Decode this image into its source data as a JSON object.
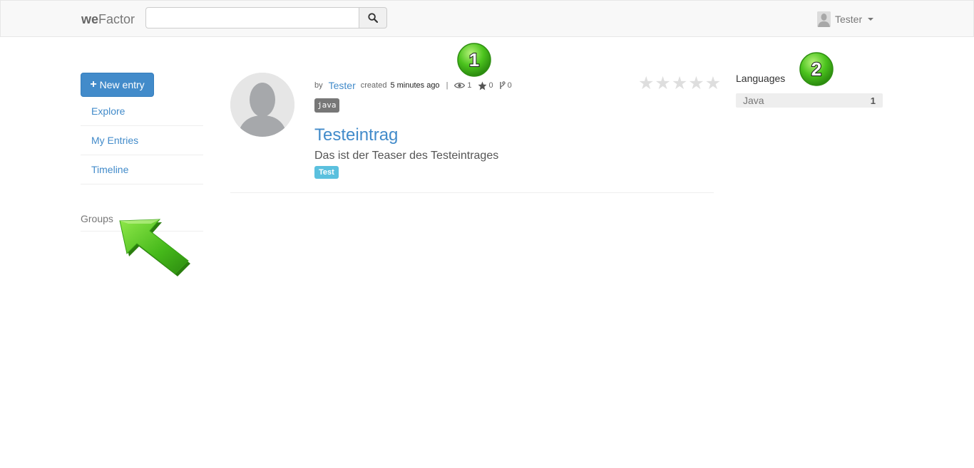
{
  "navbar": {
    "brand_bold": "we",
    "brand_rest": "Factor",
    "search": {
      "value": "",
      "placeholder": ""
    },
    "user_name": "Tester"
  },
  "sidebar": {
    "new_entry_label": "New entry",
    "nav_items": [
      {
        "label": "Explore"
      },
      {
        "label": "My Entries"
      },
      {
        "label": "Timeline"
      }
    ],
    "groups_title": "Groups"
  },
  "entry": {
    "by_label": "by",
    "author": "Tester",
    "created_label": "created",
    "created_ago": "5 minutes ago",
    "separator": "|",
    "views": "1",
    "stars": "0",
    "forks": "0",
    "language_badge": "java",
    "title": "Testeintrag",
    "teaser": "Das ist der Teaser des Testeintrages",
    "tag": "Test",
    "rating": 0,
    "rating_max": 5
  },
  "languages": {
    "title": "Languages",
    "items": [
      {
        "name": "Java",
        "count": "1"
      }
    ]
  },
  "annotations": {
    "callout_1": "1",
    "callout_2": "2"
  },
  "colors": {
    "primary": "#428bca",
    "info": "#5bc0de",
    "callout_green": "#3fb51c",
    "arrow_green": "#55c820"
  }
}
